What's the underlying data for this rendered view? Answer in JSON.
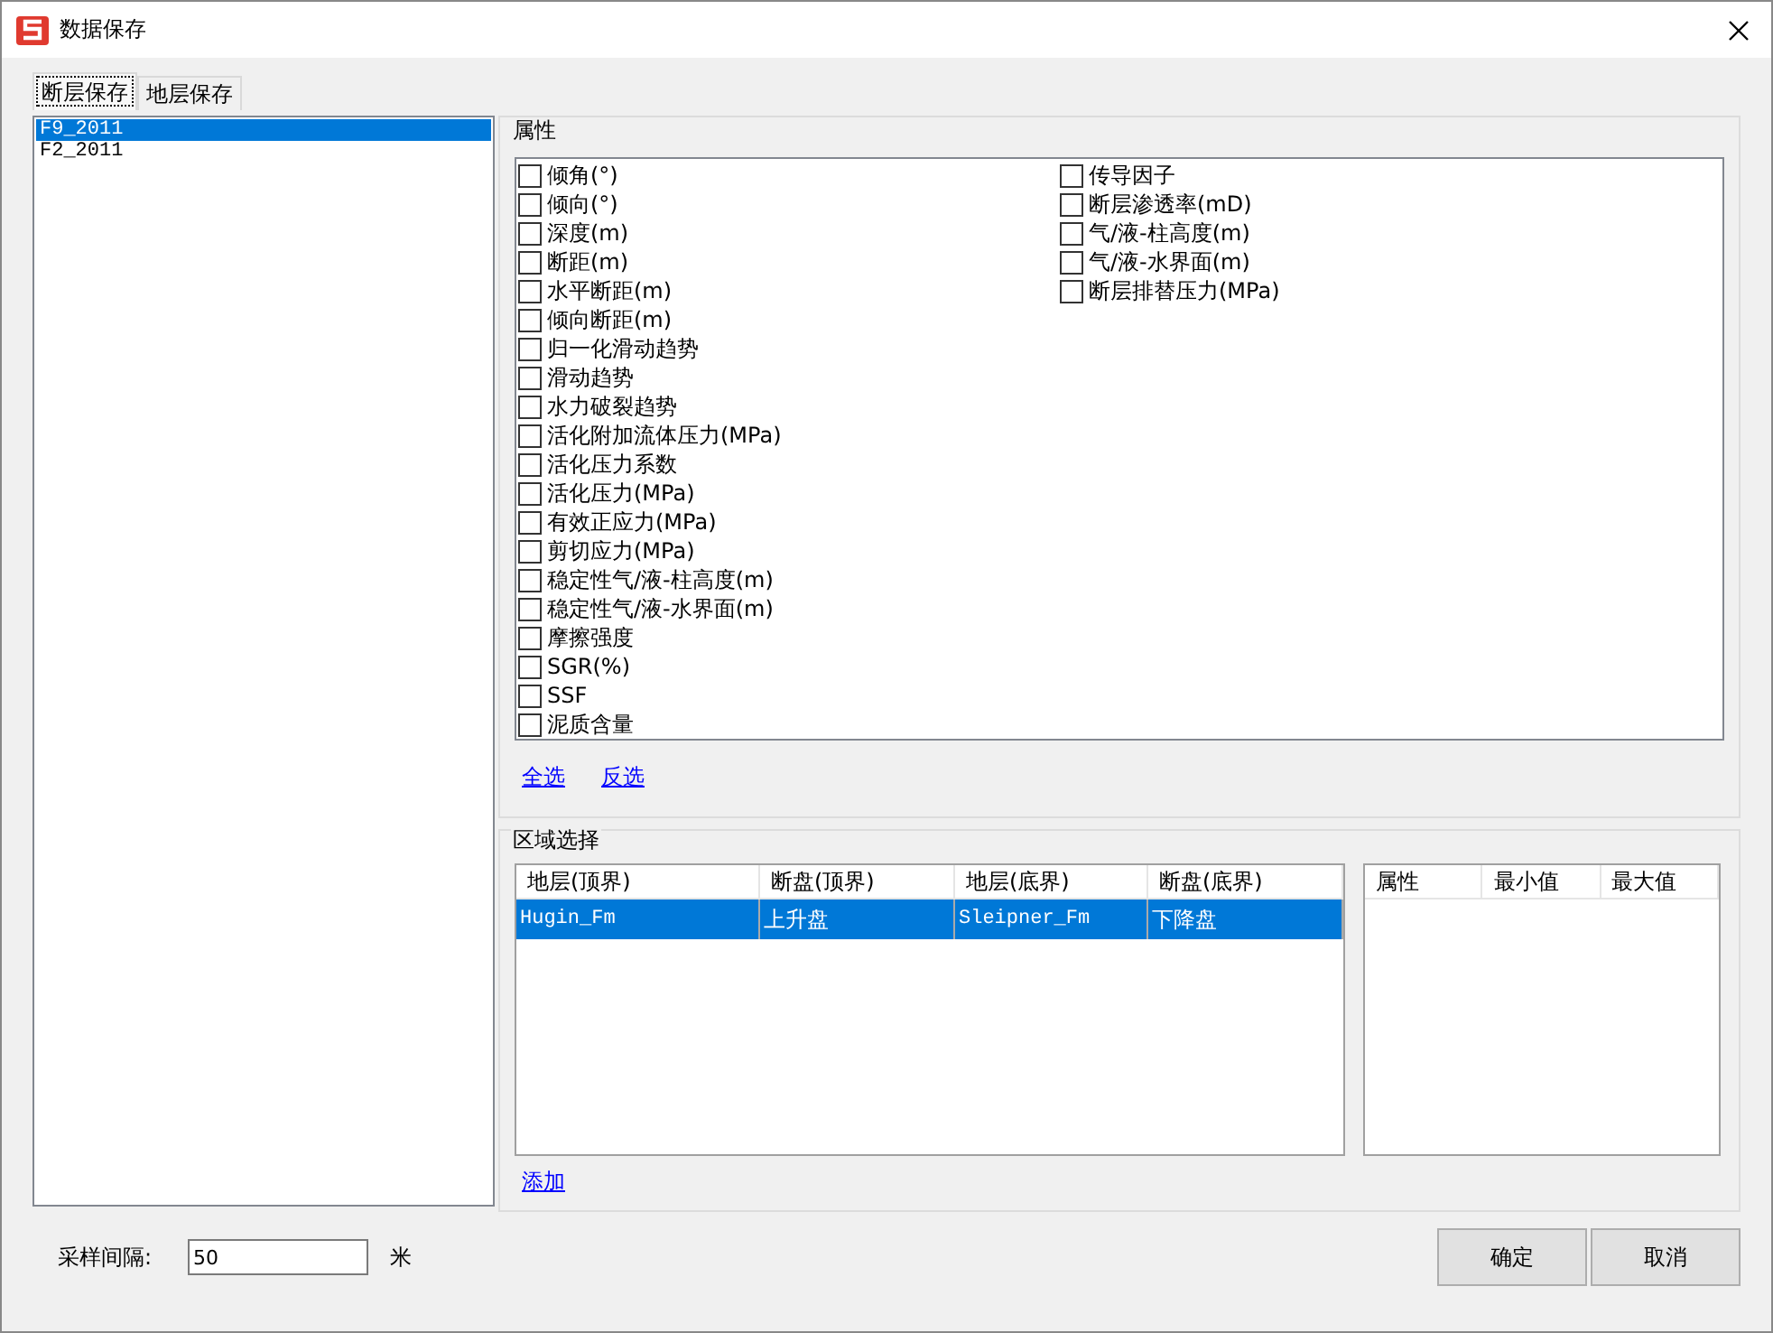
{
  "window": {
    "title": "数据保存"
  },
  "tabs": [
    {
      "label": "断层保存",
      "selected": true
    },
    {
      "label": "地层保存",
      "selected": false
    }
  ],
  "fault_list": [
    {
      "label": "F9_2011",
      "selected": true
    },
    {
      "label": "F2_2011",
      "selected": false
    }
  ],
  "attributes": {
    "title": "属性",
    "columns": [
      [
        {
          "label": "倾角(°)",
          "checked": false
        },
        {
          "label": "倾向(°)",
          "checked": false
        },
        {
          "label": "深度(m)",
          "checked": false
        },
        {
          "label": "断距(m)",
          "checked": false
        },
        {
          "label": "水平断距(m)",
          "checked": false
        },
        {
          "label": "倾向断距(m)",
          "checked": false
        },
        {
          "label": "归一化滑动趋势",
          "checked": false
        },
        {
          "label": "滑动趋势",
          "checked": false
        },
        {
          "label": "水力破裂趋势",
          "checked": false
        },
        {
          "label": "活化附加流体压力(MPa)",
          "checked": false
        },
        {
          "label": "活化压力系数",
          "checked": false
        },
        {
          "label": "活化压力(MPa)",
          "checked": false
        },
        {
          "label": "有效正应力(MPa)",
          "checked": false
        },
        {
          "label": "剪切应力(MPa)",
          "checked": false
        },
        {
          "label": "稳定性气/液-柱高度(m)",
          "checked": false
        },
        {
          "label": "稳定性气/液-水界面(m)",
          "checked": false
        },
        {
          "label": "摩擦强度",
          "checked": false
        },
        {
          "label": "SGR(%)",
          "checked": false
        },
        {
          "label": "SSF",
          "checked": false
        },
        {
          "label": "泥质含量",
          "checked": false
        }
      ],
      [
        {
          "label": "传导因子",
          "checked": false
        },
        {
          "label": "断层渗透率(mD)",
          "checked": false
        },
        {
          "label": "气/液-柱高度(m)",
          "checked": false
        },
        {
          "label": "气/液-水界面(m)",
          "checked": false
        },
        {
          "label": "断层排替压力(MPa)",
          "checked": false
        }
      ]
    ],
    "links": [
      "全选",
      "反选"
    ]
  },
  "region": {
    "title": "区域选择",
    "table": {
      "columns": [
        "地层(顶界)",
        "断盘(顶界)",
        "地层(底界)",
        "断盘(底界)"
      ],
      "rows": [
        {
          "cells": [
            "Hugin_Fm",
            "上升盘",
            "Sleipner_Fm",
            "下降盘"
          ],
          "selected": true
        }
      ]
    },
    "range_table": {
      "columns": [
        "属性",
        "最小值",
        "最大值"
      ]
    },
    "add_link": "添加"
  },
  "sampling": {
    "label": "采样间隔:",
    "value": "50",
    "unit": "米"
  },
  "buttons": [
    "确定",
    "取消"
  ]
}
